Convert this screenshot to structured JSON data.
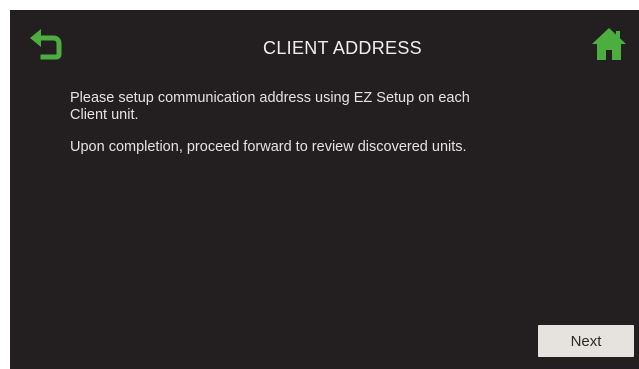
{
  "header": {
    "title": "CLIENT ADDRESS",
    "back_icon": "back-arrow-icon",
    "home_icon": "home-icon"
  },
  "content": {
    "paragraph_1": "Please setup communication address using EZ Setup on each Client unit.",
    "paragraph_2": "Upon completion, proceed forward to review discovered units."
  },
  "footer": {
    "next_label": "Next"
  },
  "colors": {
    "background": "#231f20",
    "accent_green": "#4cae3f",
    "text": "#e9e9e9",
    "button_bg": "#e6e3de"
  }
}
